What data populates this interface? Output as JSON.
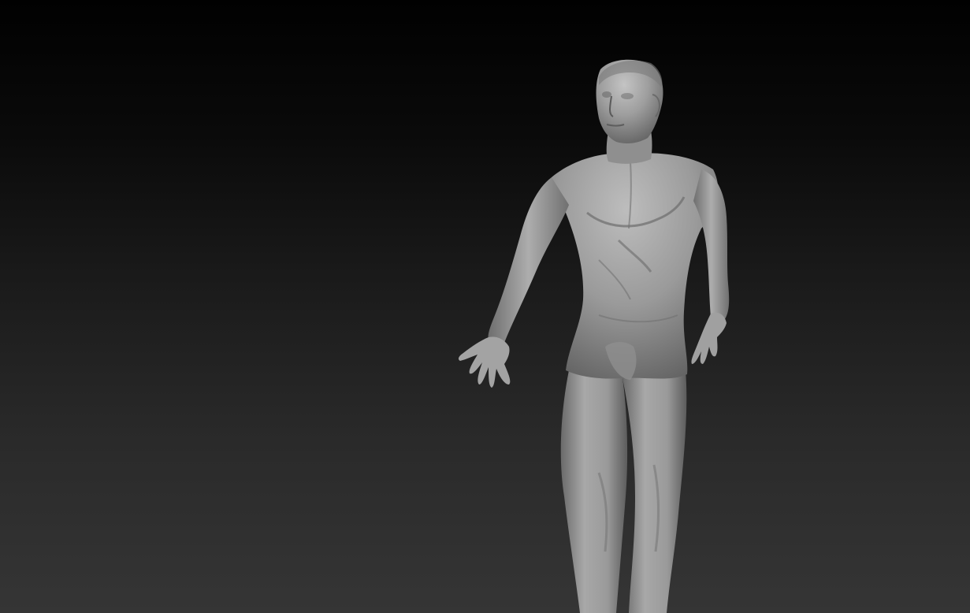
{
  "viewport": {
    "background_top": "#010101",
    "background_bottom": "#353535"
  },
  "model": {
    "subject": "sculpted-human-figure",
    "material_color": "#9a9a9a",
    "highlight_color": "#c4c4c4",
    "shadow_color": "#4e4e4e"
  }
}
